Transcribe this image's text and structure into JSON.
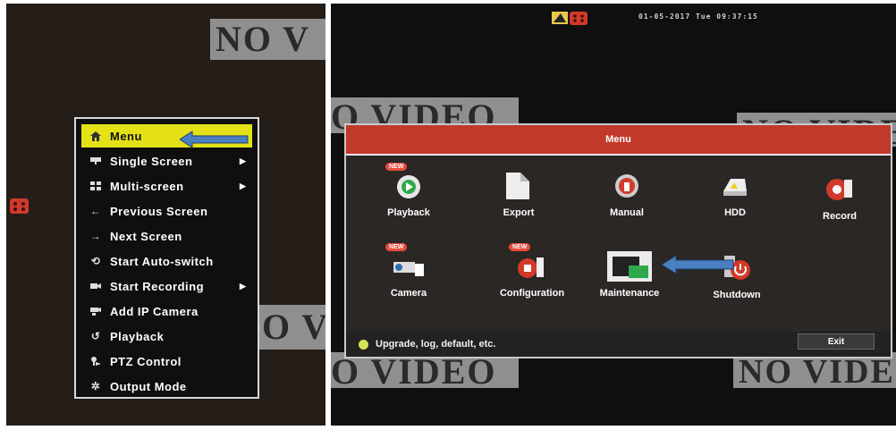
{
  "left_panel": {
    "no_video_text": [
      "NO V",
      "O V"
    ],
    "context_menu": {
      "items": [
        {
          "label": "Menu",
          "icon": "home-icon",
          "submenu": false,
          "active": true
        },
        {
          "label": "Single Screen",
          "icon": "single-screen-icon",
          "submenu": true
        },
        {
          "label": "Multi-screen",
          "icon": "multi-screen-icon",
          "submenu": true
        },
        {
          "label": "Previous Screen",
          "icon": "arrow-left-icon",
          "submenu": false
        },
        {
          "label": "Next Screen",
          "icon": "arrow-right-icon",
          "submenu": false
        },
        {
          "label": "Start Auto-switch",
          "icon": "auto-switch-icon",
          "submenu": false
        },
        {
          "label": "Start Recording",
          "icon": "record-icon",
          "submenu": true
        },
        {
          "label": "Add IP Camera",
          "icon": "ip-camera-icon",
          "submenu": false
        },
        {
          "label": "Playback",
          "icon": "playback-icon",
          "submenu": false
        },
        {
          "label": "PTZ Control",
          "icon": "ptz-icon",
          "submenu": false
        },
        {
          "label": "Output Mode",
          "icon": "output-mode-icon",
          "submenu": false
        }
      ]
    }
  },
  "right_panel": {
    "datetime": "01-05-2017 Tue 09:37:15",
    "no_video_text": [
      "O VIDEO",
      "NO VIDE",
      "O VIDEO",
      "NO VIDEO"
    ],
    "menu_window": {
      "title": "Menu",
      "tiles": [
        {
          "label": "Playback",
          "icon": "playback-icon",
          "new": true
        },
        {
          "label": "Export",
          "icon": "export-icon",
          "new": false
        },
        {
          "label": "Manual",
          "icon": "manual-icon",
          "new": false
        },
        {
          "label": "HDD",
          "icon": "hdd-icon",
          "new": false
        },
        {
          "label": "Record",
          "icon": "record-icon",
          "new": false
        },
        {
          "label": "Camera",
          "icon": "camera-icon",
          "new": true
        },
        {
          "label": "Configuration",
          "icon": "configuration-icon",
          "new": true
        },
        {
          "label": "Maintenance",
          "icon": "maintenance-icon",
          "new": false
        },
        {
          "label": "Shutdown",
          "icon": "shutdown-icon",
          "new": false
        }
      ],
      "new_badge": "NEW",
      "hint": "Upgrade, log, default, etc.",
      "exit_label": "Exit"
    }
  },
  "colors": {
    "title_bar": "#c0392b",
    "highlight": "#e5e117",
    "annotation_arrow": "#4a7fc1"
  }
}
